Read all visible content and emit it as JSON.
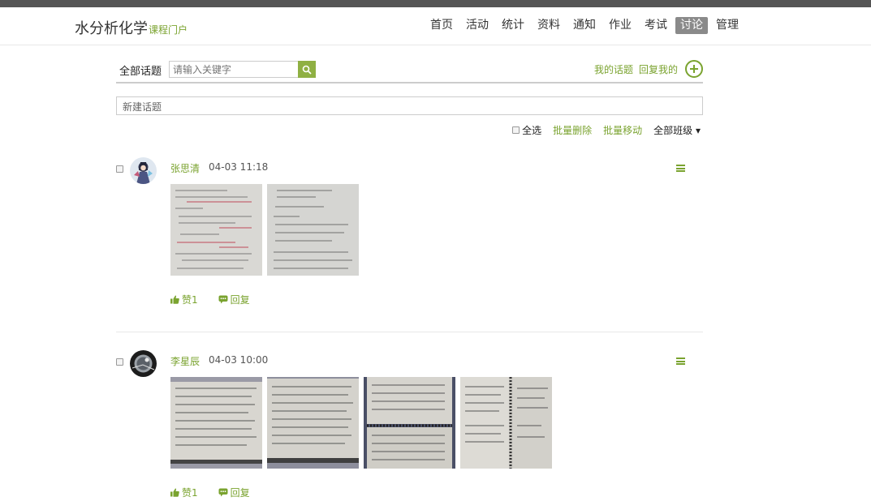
{
  "header": {
    "logo_main": "水分析化学",
    "logo_sub": "课程门户",
    "nav": [
      {
        "label": "首页",
        "active": false
      },
      {
        "label": "活动",
        "active": false
      },
      {
        "label": "统计",
        "active": false
      },
      {
        "label": "资料",
        "active": false
      },
      {
        "label": "通知",
        "active": false
      },
      {
        "label": "作业",
        "active": false
      },
      {
        "label": "考试",
        "active": false
      },
      {
        "label": "讨论",
        "active": true
      },
      {
        "label": "管理",
        "active": false
      }
    ]
  },
  "toolbar": {
    "all_topics": "全部话题",
    "search_placeholder": "请输入关键字",
    "my_topics": "我的话题",
    "replied_to_me": "回复我的"
  },
  "new_topic_placeholder": "新建话题",
  "batch": {
    "select_all": "全选",
    "batch_delete": "批量删除",
    "batch_move": "批量移动",
    "class_filter": "全部班级 ▾"
  },
  "posts": [
    {
      "author": "张思清",
      "time": "04-03 11:18",
      "likes": "赞1",
      "reply": "回复",
      "image_count": 2
    },
    {
      "author": "李星辰",
      "time": "04-03 10:00",
      "likes": "赞1",
      "reply": "回复",
      "image_count": 4
    }
  ],
  "colors": {
    "accent": "#7aa32f",
    "nav_active_bg": "#8a8a8a",
    "top_bar": "#555555"
  }
}
